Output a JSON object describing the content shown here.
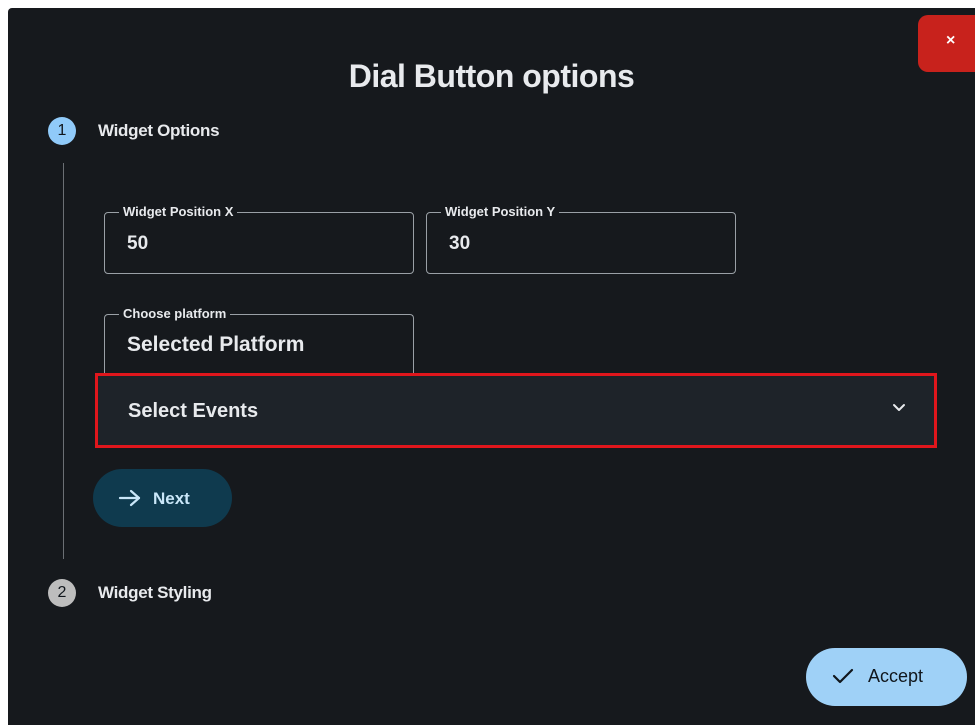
{
  "dialog": {
    "title": "Dial Button options",
    "close_label": "×"
  },
  "stepper": {
    "steps": [
      {
        "number": "1",
        "label": "Widget Options",
        "state": "active"
      },
      {
        "number": "2",
        "label": "Widget Styling",
        "state": "inactive"
      }
    ]
  },
  "form": {
    "position_x": {
      "label": "Widget Position X",
      "value": "50"
    },
    "position_y": {
      "label": "Widget Position Y",
      "value": "30"
    },
    "platform": {
      "label": "Choose platform",
      "value": "Selected Platform"
    },
    "events": {
      "label": "Select Events"
    }
  },
  "actions": {
    "next_label": "Next",
    "accept_label": "Accept"
  },
  "icons": {
    "close": "close-icon",
    "chevron": "chevron-down-icon",
    "next": "arrow-right-icon",
    "accept": "check-icon"
  },
  "colors": {
    "background": "#16191d",
    "active_step": "#90caf9",
    "close_button": "#c8221c",
    "highlight_border": "#e0161c",
    "next_button": "#0f3a4e",
    "accept_button": "#9fd1f7"
  }
}
